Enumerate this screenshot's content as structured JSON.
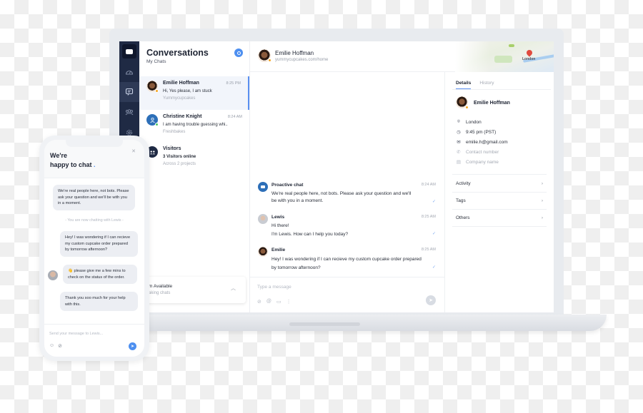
{
  "sidebar": {
    "items": [
      {
        "icon": "dashboard-icon"
      },
      {
        "icon": "chat-icon",
        "active": true
      },
      {
        "icon": "visitors-icon"
      },
      {
        "icon": "settings-icon"
      }
    ]
  },
  "conversations": {
    "title": "Conversations",
    "subtitle": "My Chats",
    "items": [
      {
        "name": "Emilie Hoffman",
        "time": "8:25 PM",
        "message": "Hi, Yes please, I am stuck",
        "project": "Yummycupcakes",
        "status_color": "#f5a623"
      },
      {
        "name": "Christine Knight",
        "time": "8:24 AM",
        "message": "I am having trouble guessing whi..",
        "project": "Freshbakes",
        "status_color": "#4cc765"
      },
      {
        "name": "Visitors",
        "message": "3 Visitors online",
        "project": "Across 2 projects"
      }
    ],
    "availability": {
      "title": "I'm Available",
      "subtitle": "Taking chats"
    }
  },
  "chat": {
    "contact_name": "Emilie Hoffman",
    "contact_url": "yummycupcakes.com/home",
    "messages": [
      {
        "sender": "Proactive chat",
        "time": "8:24 AM",
        "text": "We're real people here, not bots. Please ask your question and we'll be with you in a moment."
      },
      {
        "sender": "Lewis",
        "time": "8:25 AM",
        "line1": "Hi there!",
        "line2": "I'm Lewis. How can I help you today?"
      },
      {
        "sender": "Emilie",
        "time": "8:25 AM",
        "text": "Hey! I was wondering if I can recieve my custom cupcake order prepared by tomorrow afternoon?"
      }
    ],
    "composer_placeholder": "Type a message",
    "check_mark": "✓"
  },
  "details": {
    "map_label": "London",
    "tabs": [
      "Details",
      "History"
    ],
    "name": "Emilie Hoffman",
    "location": "London",
    "local_time": "9:45 pm (PST)",
    "email": "emilie.h@gmail.com",
    "phone_placeholder": "Contact number",
    "company_placeholder": "Company name",
    "sections": [
      "Activity",
      "Tags",
      "Others"
    ]
  },
  "widget": {
    "title_line1": "We're",
    "title_line2": "happy to chat",
    "title_dot": ".",
    "messages": [
      {
        "from": "agent",
        "text": "We're real people here, not bots. Please ask your question and we'll be with you in a moment."
      },
      {
        "from": "system",
        "text": "- You are now chatting with Lewis -"
      },
      {
        "from": "visitor",
        "text": "Hey! I was wondering if I can recieve my custom cupcake order prepared by tomorrow afternoon?"
      },
      {
        "from": "agent",
        "text": "👋 please give me a few mins to check on the status of the order."
      },
      {
        "from": "visitor",
        "text": "Thank you soo much for your help with this."
      }
    ],
    "input_placeholder": "Send your message to Lewis..."
  },
  "colors": {
    "accent": "#4d8ff0",
    "rail": "#1f2a44",
    "away": "#f5a623",
    "online": "#4cc765"
  }
}
